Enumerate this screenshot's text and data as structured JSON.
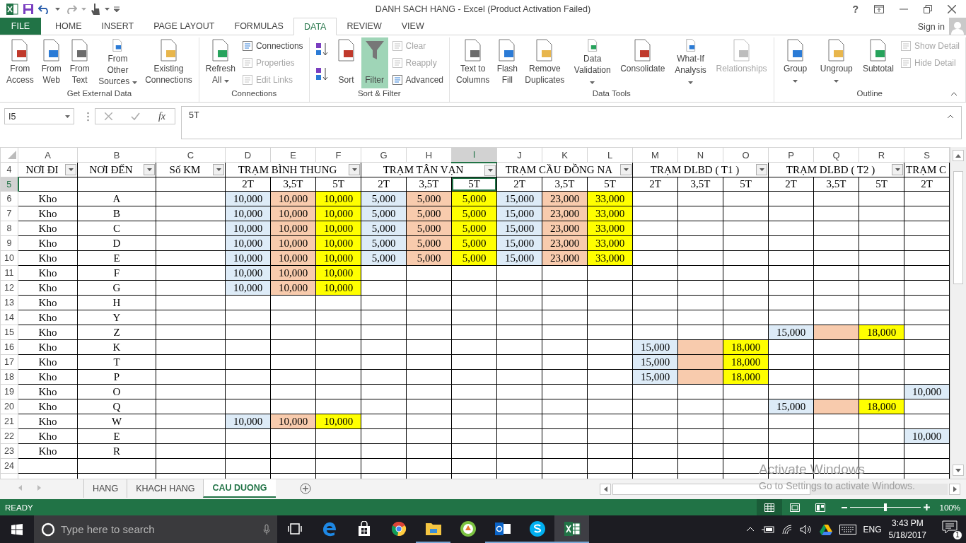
{
  "title_bar": {
    "title": "DANH SACH HANG - Excel (Product Activation Failed)",
    "help": "?"
  },
  "tabs": [
    {
      "label": "FILE",
      "kind": "file",
      "selected": false
    },
    {
      "label": "HOME",
      "kind": "tab",
      "selected": false
    },
    {
      "label": "INSERT",
      "kind": "tab",
      "selected": false
    },
    {
      "label": "PAGE LAYOUT",
      "kind": "tab",
      "selected": false
    },
    {
      "label": "FORMULAS",
      "kind": "tab",
      "selected": false
    },
    {
      "label": "DATA",
      "kind": "tab",
      "selected": true
    },
    {
      "label": "REVIEW",
      "kind": "tab",
      "selected": false
    },
    {
      "label": "VIEW",
      "kind": "tab",
      "selected": false
    }
  ],
  "account": {
    "label": "Sign in"
  },
  "ribbon": {
    "groups": [
      {
        "label": "Get External Data",
        "columns": [
          [
            {
              "kind": "large",
              "label": "From\nAccess",
              "disabled": false,
              "on": false
            }
          ],
          [
            {
              "kind": "large",
              "label": "From\nWeb",
              "disabled": false,
              "on": false
            }
          ],
          [
            {
              "kind": "large",
              "label": "From\nText",
              "disabled": false,
              "on": false
            }
          ],
          [
            {
              "kind": "large",
              "label": "From Other\nSources",
              "dropdown": true,
              "disabled": false,
              "on": false
            }
          ],
          [
            {
              "kind": "large",
              "label": "Existing\nConnections",
              "disabled": false,
              "on": false
            }
          ]
        ]
      },
      {
        "label": "Connections",
        "columns": [
          [
            {
              "kind": "large",
              "label": "Refresh\nAll",
              "dropdown": true,
              "disabled": false,
              "on": false
            }
          ],
          [
            {
              "kind": "small",
              "label": "Connections",
              "disabled": false,
              "on": false
            },
            {
              "kind": "small",
              "label": "Properties",
              "disabled": true,
              "on": false
            },
            {
              "kind": "small",
              "label": "Edit Links",
              "disabled": true,
              "on": false
            }
          ]
        ]
      },
      {
        "label": "Sort & Filter",
        "columns": [
          [
            {
              "kind": "icon",
              "disabled": false,
              "on": false
            },
            {
              "kind": "icon",
              "disabled": false,
              "on": false
            }
          ],
          [
            {
              "kind": "large",
              "label": "\nSort",
              "disabled": false,
              "on": false
            }
          ],
          [
            {
              "kind": "large",
              "label": "\nFilter",
              "disabled": false,
              "on": true
            }
          ],
          [
            {
              "kind": "small",
              "label": "Clear",
              "disabled": true,
              "on": false
            },
            {
              "kind": "small",
              "label": "Reapply",
              "disabled": true,
              "on": false
            },
            {
              "kind": "small",
              "label": "Advanced",
              "disabled": false,
              "on": false
            }
          ]
        ]
      },
      {
        "label": "Data Tools",
        "columns": [
          [
            {
              "kind": "large",
              "label": "Text to\nColumns",
              "disabled": false,
              "on": false
            }
          ],
          [
            {
              "kind": "large",
              "label": "Flash\nFill",
              "disabled": false,
              "on": false
            }
          ],
          [
            {
              "kind": "large",
              "label": "Remove\nDuplicates",
              "disabled": false,
              "on": false
            }
          ],
          [
            {
              "kind": "large",
              "label": "Data\nValidation",
              "dropdown": true,
              "disabled": false,
              "on": false
            }
          ],
          [
            {
              "kind": "large",
              "label": "Consolidate",
              "disabled": false,
              "on": false
            }
          ],
          [
            {
              "kind": "large",
              "label": "What-If\nAnalysis",
              "dropdown": true,
              "disabled": false,
              "on": false
            }
          ],
          [
            {
              "kind": "large",
              "label": "Relationships",
              "disabled": true,
              "on": false
            }
          ]
        ]
      },
      {
        "label": "Outline",
        "columns": [
          [
            {
              "kind": "large",
              "label": "Group",
              "dropdown": true,
              "disabled": false,
              "on": false
            }
          ],
          [
            {
              "kind": "large",
              "label": "Ungroup",
              "dropdown": true,
              "disabled": false,
              "on": false
            }
          ],
          [
            {
              "kind": "large",
              "label": "Subtotal",
              "disabled": false,
              "on": false
            }
          ],
          [
            {
              "kind": "small",
              "label": "Show Detail",
              "disabled": true,
              "on": false
            },
            {
              "kind": "small",
              "label": "Hide Detail",
              "disabled": true,
              "on": false
            }
          ]
        ]
      }
    ]
  },
  "formula_bar": {
    "name_box": "I5",
    "function_label": "fx",
    "value": "5T"
  },
  "sheet": {
    "columns": [
      {
        "letter": "A",
        "selected": false
      },
      {
        "letter": "B",
        "selected": false
      },
      {
        "letter": "C",
        "selected": false
      },
      {
        "letter": "D",
        "selected": false
      },
      {
        "letter": "E",
        "selected": false
      },
      {
        "letter": "F",
        "selected": false
      },
      {
        "letter": "G",
        "selected": false
      },
      {
        "letter": "H",
        "selected": false
      },
      {
        "letter": "I",
        "selected": true
      },
      {
        "letter": "J",
        "selected": false
      },
      {
        "letter": "K",
        "selected": false
      },
      {
        "letter": "L",
        "selected": false
      },
      {
        "letter": "M",
        "selected": false
      },
      {
        "letter": "N",
        "selected": false
      },
      {
        "letter": "O",
        "selected": false
      },
      {
        "letter": "P",
        "selected": false
      },
      {
        "letter": "Q",
        "selected": false
      },
      {
        "letter": "R",
        "selected": false
      },
      {
        "letter": "S",
        "selected": false
      }
    ],
    "header_row": {
      "num": "4",
      "selected": false
    },
    "groups": [
      {
        "label": "NƠI ĐI",
        "filter": true
      },
      {
        "label": "NƠI ĐẾN",
        "filter": true
      },
      {
        "label": "Số KM",
        "filter": true
      },
      {
        "label": "TRẠM BÌNH THUNG",
        "filter": true,
        "subheaders": [
          "2T",
          "3,5T",
          "5T"
        ]
      },
      {
        "label": "TRẠM TÂN VẠN",
        "filter": true,
        "subheaders": [
          "2T",
          "3,5T",
          "5T"
        ]
      },
      {
        "label": "TRẠM CẦU ĐỒNG NA",
        "filter": true,
        "subheaders": [
          "2T",
          "3,5T",
          "5T"
        ]
      },
      {
        "label": "TRẠM DLBD ( T1 )",
        "filter": true,
        "subheaders": [
          "2T",
          "3,5T",
          "5T"
        ]
      },
      {
        "label": "TRẠM DLBD ( T2 )",
        "filter": true,
        "subheaders": [
          "2T",
          "3,5T",
          "5T"
        ]
      },
      {
        "label": "TRẠM C",
        "filter": false,
        "subheaders": [
          "2T"
        ]
      }
    ],
    "sub_row": {
      "num": "5",
      "selected": true
    },
    "rows": [
      {
        "num": "6",
        "selected": false,
        "cells": [
          {
            "text": "Kho"
          },
          {
            "text": "A"
          },
          {},
          {
            "text": "10,000",
            "color": "#ddebf7"
          },
          {
            "text": "10,000",
            "color": "#f8cbad"
          },
          {
            "text": "10,000",
            "color": "#ffff00"
          },
          {
            "text": "5,000",
            "color": "#ddebf7"
          },
          {
            "text": "5,000",
            "color": "#f8cbad"
          },
          {
            "text": "5,000",
            "color": "#ffff00"
          },
          {
            "text": "15,000",
            "color": "#ddebf7"
          },
          {
            "text": "23,000",
            "color": "#f8cbad"
          },
          {
            "text": "33,000",
            "color": "#ffff00"
          }
        ]
      },
      {
        "num": "7",
        "selected": false,
        "cells": [
          {
            "text": "Kho"
          },
          {
            "text": "B"
          },
          {},
          {
            "text": "10,000",
            "color": "#ddebf7"
          },
          {
            "text": "10,000",
            "color": "#f8cbad"
          },
          {
            "text": "10,000",
            "color": "#ffff00"
          },
          {
            "text": "5,000",
            "color": "#ddebf7"
          },
          {
            "text": "5,000",
            "color": "#f8cbad"
          },
          {
            "text": "5,000",
            "color": "#ffff00"
          },
          {
            "text": "15,000",
            "color": "#ddebf7"
          },
          {
            "text": "23,000",
            "color": "#f8cbad"
          },
          {
            "text": "33,000",
            "color": "#ffff00"
          }
        ]
      },
      {
        "num": "8",
        "selected": false,
        "cells": [
          {
            "text": "Kho"
          },
          {
            "text": "C"
          },
          {},
          {
            "text": "10,000",
            "color": "#ddebf7"
          },
          {
            "text": "10,000",
            "color": "#f8cbad"
          },
          {
            "text": "10,000",
            "color": "#ffff00"
          },
          {
            "text": "5,000",
            "color": "#ddebf7"
          },
          {
            "text": "5,000",
            "color": "#f8cbad"
          },
          {
            "text": "5,000",
            "color": "#ffff00"
          },
          {
            "text": "15,000",
            "color": "#ddebf7"
          },
          {
            "text": "23,000",
            "color": "#f8cbad"
          },
          {
            "text": "33,000",
            "color": "#ffff00"
          }
        ]
      },
      {
        "num": "9",
        "selected": false,
        "cells": [
          {
            "text": "Kho"
          },
          {
            "text": "D"
          },
          {},
          {
            "text": "10,000",
            "color": "#ddebf7"
          },
          {
            "text": "10,000",
            "color": "#f8cbad"
          },
          {
            "text": "10,000",
            "color": "#ffff00"
          },
          {
            "text": "5,000",
            "color": "#ddebf7"
          },
          {
            "text": "5,000",
            "color": "#f8cbad"
          },
          {
            "text": "5,000",
            "color": "#ffff00"
          },
          {
            "text": "15,000",
            "color": "#ddebf7"
          },
          {
            "text": "23,000",
            "color": "#f8cbad"
          },
          {
            "text": "33,000",
            "color": "#ffff00"
          }
        ]
      },
      {
        "num": "10",
        "selected": false,
        "cells": [
          {
            "text": "Kho"
          },
          {
            "text": "E"
          },
          {},
          {
            "text": "10,000",
            "color": "#ddebf7"
          },
          {
            "text": "10,000",
            "color": "#f8cbad"
          },
          {
            "text": "10,000",
            "color": "#ffff00"
          },
          {
            "text": "5,000",
            "color": "#ddebf7"
          },
          {
            "text": "5,000",
            "color": "#f8cbad"
          },
          {
            "text": "5,000",
            "color": "#ffff00"
          },
          {
            "text": "15,000",
            "color": "#ddebf7"
          },
          {
            "text": "23,000",
            "color": "#f8cbad"
          },
          {
            "text": "33,000",
            "color": "#ffff00"
          }
        ]
      },
      {
        "num": "11",
        "selected": false,
        "cells": [
          {
            "text": "Kho"
          },
          {
            "text": "F"
          },
          {},
          {
            "text": "10,000",
            "color": "#ddebf7"
          },
          {
            "text": "10,000",
            "color": "#f8cbad"
          },
          {
            "text": "10,000",
            "color": "#ffff00"
          }
        ]
      },
      {
        "num": "12",
        "selected": false,
        "cells": [
          {
            "text": "Kho"
          },
          {
            "text": "G"
          },
          {},
          {
            "text": "10,000",
            "color": "#ddebf7"
          },
          {
            "text": "10,000",
            "color": "#f8cbad"
          },
          {
            "text": "10,000",
            "color": "#ffff00"
          }
        ]
      },
      {
        "num": "13",
        "selected": false,
        "cells": [
          {
            "text": "Kho"
          },
          {
            "text": "H"
          }
        ]
      },
      {
        "num": "14",
        "selected": false,
        "cells": [
          {
            "text": "Kho"
          },
          {
            "text": "Y"
          }
        ]
      },
      {
        "num": "15",
        "selected": false,
        "cells": [
          {
            "text": "Kho"
          },
          {
            "text": "Z"
          },
          {},
          {},
          {},
          {},
          {},
          {},
          {},
          {},
          {},
          {},
          {},
          {},
          {},
          {
            "text": "15,000",
            "color": "#ddebf7"
          },
          {
            "color": "#f8cbad"
          },
          {
            "text": "18,000",
            "color": "#ffff00"
          }
        ]
      },
      {
        "num": "16",
        "selected": false,
        "cells": [
          {
            "text": "Kho"
          },
          {
            "text": "K"
          },
          {},
          {},
          {},
          {},
          {},
          {},
          {},
          {},
          {},
          {},
          {
            "text": "15,000",
            "color": "#ddebf7"
          },
          {
            "color": "#f8cbad"
          },
          {
            "text": "18,000",
            "color": "#ffff00"
          }
        ]
      },
      {
        "num": "17",
        "selected": false,
        "cells": [
          {
            "text": "Kho"
          },
          {
            "text": "T"
          },
          {},
          {},
          {},
          {},
          {},
          {},
          {},
          {},
          {},
          {},
          {
            "text": "15,000",
            "color": "#ddebf7"
          },
          {
            "color": "#f8cbad"
          },
          {
            "text": "18,000",
            "color": "#ffff00"
          }
        ]
      },
      {
        "num": "18",
        "selected": false,
        "cells": [
          {
            "text": "Kho"
          },
          {
            "text": "P"
          },
          {},
          {},
          {},
          {},
          {},
          {},
          {},
          {},
          {},
          {},
          {
            "text": "15,000",
            "color": "#ddebf7"
          },
          {
            "color": "#f8cbad"
          },
          {
            "text": "18,000",
            "color": "#ffff00"
          }
        ]
      },
      {
        "num": "19",
        "selected": false,
        "cells": [
          {
            "text": "Kho"
          },
          {
            "text": "O"
          },
          {},
          {},
          {},
          {},
          {},
          {},
          {},
          {},
          {},
          {},
          {},
          {},
          {},
          {},
          {},
          {},
          {
            "text": "10,000",
            "color": "#ddebf7"
          }
        ]
      },
      {
        "num": "20",
        "selected": false,
        "cells": [
          {
            "text": "Kho"
          },
          {
            "text": "Q"
          },
          {},
          {},
          {},
          {},
          {},
          {},
          {},
          {},
          {},
          {},
          {},
          {},
          {},
          {
            "text": "15,000",
            "color": "#ddebf7"
          },
          {
            "color": "#f8cbad"
          },
          {
            "text": "18,000",
            "color": "#ffff00"
          }
        ]
      },
      {
        "num": "21",
        "selected": false,
        "cells": [
          {
            "text": "Kho"
          },
          {
            "text": "W"
          },
          {},
          {
            "text": "10,000",
            "color": "#ddebf7"
          },
          {
            "text": "10,000",
            "color": "#f8cbad"
          },
          {
            "text": "10,000",
            "color": "#ffff00"
          }
        ]
      },
      {
        "num": "22",
        "selected": false,
        "cells": [
          {
            "text": "Kho"
          },
          {
            "text": "E"
          },
          {},
          {},
          {},
          {},
          {},
          {},
          {},
          {},
          {},
          {},
          {},
          {},
          {},
          {},
          {},
          {},
          {
            "text": "10,000",
            "color": "#ddebf7"
          }
        ]
      },
      {
        "num": "23",
        "selected": false,
        "cells": [
          {
            "text": "Kho"
          },
          {
            "text": "R"
          }
        ]
      },
      {
        "num": "24",
        "selected": false
      }
    ]
  },
  "overlay": {
    "title": "Activate Windows",
    "message": "Go to Settings to activate Windows."
  },
  "sheet_tabs": [
    {
      "label": "HANG",
      "selected": false
    },
    {
      "label": "KHACH HANG",
      "selected": false
    },
    {
      "label": "CAU DUONG",
      "selected": true
    }
  ],
  "status_bar": {
    "status": "READY",
    "views": [
      {
        "kind": "normal",
        "selected": true
      },
      {
        "kind": "page-layout",
        "selected": false
      },
      {
        "kind": "page-break",
        "selected": false
      }
    ],
    "zoom": {
      "level": 0.5,
      "reading": "100%"
    }
  },
  "taskbar": {
    "search_placeholder": "Type here to search",
    "apps": [
      {
        "kind": "task-view",
        "running": false,
        "selected": false
      },
      {
        "kind": "browser",
        "running": false,
        "selected": false
      },
      {
        "kind": "store",
        "running": false,
        "selected": false
      },
      {
        "kind": "ball",
        "running": false,
        "selected": false
      },
      {
        "kind": "folder",
        "running": true,
        "selected": false
      },
      {
        "kind": "green",
        "running": false,
        "selected": false
      },
      {
        "kind": "mail",
        "running": true,
        "selected": false
      },
      {
        "kind": "chat",
        "running": true,
        "selected": false
      },
      {
        "kind": "sheet",
        "running": true,
        "selected": true
      }
    ],
    "language": "ENG",
    "time": "3:43 PM",
    "date": "5/18/2017",
    "notifications": "1"
  }
}
